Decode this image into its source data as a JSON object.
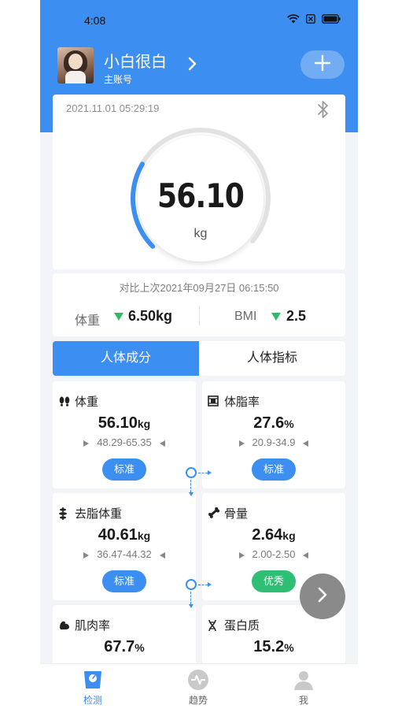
{
  "status": {
    "time": "4:08"
  },
  "user": {
    "name": "小白很白",
    "subtitle": "主账号"
  },
  "weight_card": {
    "timestamp": "2021.11.01 05:29:19",
    "weight": "56.10",
    "unit": "kg",
    "progress": 0.28
  },
  "compare": {
    "text": "对比上次2021年09月27日 06:15:50",
    "weight_label": "体重",
    "weight_delta": "6.50kg",
    "bmi_label": "BMI",
    "bmi_delta": "2.5"
  },
  "tabs": {
    "active": "人体成分",
    "inactive": "人体指标"
  },
  "metrics": [
    {
      "title": "体重",
      "value": "56.10",
      "unit": "kg",
      "range": "48.29-65.35",
      "badge": "标准",
      "badge_color": "#3c8ef0",
      "icon": "footprints-icon"
    },
    {
      "title": "体脂率",
      "value": "27.6",
      "unit": "%",
      "range": "20.9-34.9",
      "badge": "标准",
      "badge_color": "#3c8ef0",
      "icon": "body-fat-icon"
    },
    {
      "title": "去脂体重",
      "value": "40.61",
      "unit": "kg",
      "range": "36.47-44.32",
      "badge": "标准",
      "badge_color": "#3c8ef0",
      "icon": "spine-icon"
    },
    {
      "title": "骨量",
      "value": "2.64",
      "unit": "kg",
      "range": "2.00-2.50",
      "badge": "优秀",
      "badge_color": "#2fbf74",
      "icon": "bone-icon"
    },
    {
      "title": "肌肉率",
      "value": "67.7",
      "unit": "%",
      "icon": "muscle-icon"
    },
    {
      "title": "蛋白质",
      "value": "15.2",
      "unit": "%",
      "icon": "dna-icon"
    }
  ],
  "nav": [
    {
      "label": "检测",
      "icon": "scale-icon",
      "active": true
    },
    {
      "label": "趋势",
      "icon": "trend-icon",
      "active": false
    },
    {
      "label": "我",
      "icon": "profile-icon",
      "active": false
    }
  ],
  "colors": {
    "primary": "#3c8ef0",
    "good": "#2fbf74",
    "down_arrow": "#2fbb66"
  }
}
